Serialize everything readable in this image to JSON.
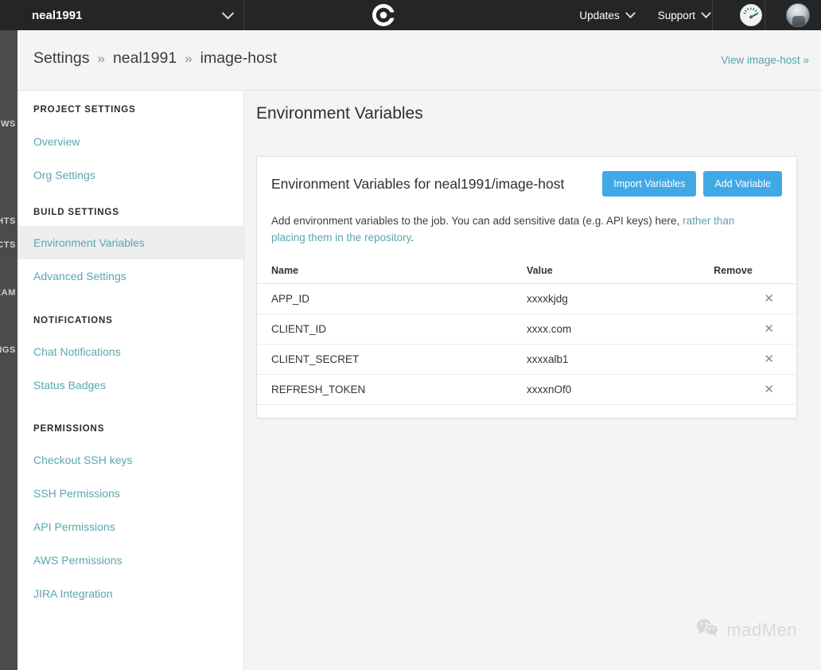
{
  "topbar": {
    "org_name": "neal1991",
    "org_switcher_icon": "chevron-down-icon",
    "logo_icon": "circleci-logo-icon",
    "nav": [
      {
        "label": "Updates",
        "icon": "chevron-down-icon"
      },
      {
        "label": "Support",
        "icon": "chevron-down-icon"
      }
    ],
    "gauge_icon": "speedometer-icon",
    "avatar_icon": "user-avatar"
  },
  "rail": {
    "labels": [
      "WORKFLOWS",
      "INSIGHTS",
      "PROJECTS",
      "TEAM",
      "SETTINGS"
    ]
  },
  "header": {
    "breadcrumb": [
      {
        "label": "Settings"
      },
      {
        "label": "neal1991"
      },
      {
        "label": "image-host"
      }
    ],
    "separator": "»",
    "view_link": "View image-host »"
  },
  "sidebar": {
    "sections": [
      {
        "title": "PROJECT SETTINGS",
        "items": [
          {
            "label": "Overview",
            "active": false
          },
          {
            "label": "Org Settings",
            "active": false
          }
        ]
      },
      {
        "title": "BUILD SETTINGS",
        "items": [
          {
            "label": "Environment Variables",
            "active": true
          },
          {
            "label": "Advanced Settings",
            "active": false
          }
        ]
      },
      {
        "title": "NOTIFICATIONS",
        "items": [
          {
            "label": "Chat Notifications",
            "active": false
          },
          {
            "label": "Status Badges",
            "active": false
          }
        ]
      },
      {
        "title": "PERMISSIONS",
        "items": [
          {
            "label": "Checkout SSH keys",
            "active": false
          },
          {
            "label": "SSH Permissions",
            "active": false
          },
          {
            "label": "API Permissions",
            "active": false
          },
          {
            "label": "AWS Permissions",
            "active": false
          },
          {
            "label": "JIRA Integration",
            "active": false
          }
        ]
      }
    ]
  },
  "main": {
    "page_title": "Environment Variables",
    "card": {
      "heading": "Environment Variables for neal1991/image-host",
      "import_button": "Import Variables",
      "add_button": "Add Variable",
      "description_part1": "Add environment variables to the job. You can add sensitive data (e.g. API keys) here, ",
      "description_link": "rather than placing them in the repository",
      "description_part2": ".",
      "table": {
        "columns": [
          "Name",
          "Value",
          "Remove"
        ],
        "remove_icon": "close-x-icon",
        "rows": [
          {
            "name": "APP_ID",
            "value": "xxxxkjdg"
          },
          {
            "name": "CLIENT_ID",
            "value": "xxxx.com"
          },
          {
            "name": "CLIENT_SECRET",
            "value": "xxxxalb1"
          },
          {
            "name": "REFRESH_TOKEN",
            "value": "xxxxnOf0"
          }
        ]
      }
    }
  },
  "watermark": {
    "icon": "wechat-icon",
    "text": "madMen"
  },
  "colors": {
    "accent_blue": "#41a8e6",
    "link_teal": "#5aa6ae",
    "topbar_dark": "#252525",
    "rail_dark": "#4b4b4b",
    "page_bg": "#f4f4f4"
  }
}
